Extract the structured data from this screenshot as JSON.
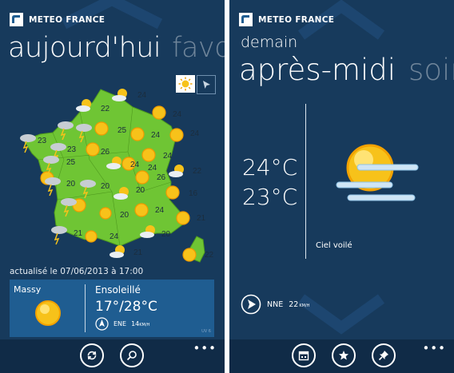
{
  "left": {
    "brand": "METEO FRANCE",
    "pivot_current": "aujourd'hui",
    "pivot_next": "favo",
    "map": {
      "temperatures": [
        "24",
        "22",
        "24",
        "25",
        "24",
        "23",
        "24",
        "24",
        "26",
        "23",
        "24",
        "25",
        "24",
        "22",
        "20",
        "26",
        "16",
        "20",
        "20",
        "24",
        "21",
        "21",
        "20",
        "24",
        "20",
        "22"
      ],
      "toolbar_icons": [
        "sun-icon",
        "cursor-icon"
      ]
    },
    "updated": "actualisé le 07/06/2013 à 17:00",
    "tile": {
      "city": "Massy",
      "condition": "Ensoleillé",
      "temps": "17°/28°C",
      "wind_dir": "ENE",
      "wind_speed": "14",
      "wind_unit": "KM/H",
      "uv": "UV 6"
    },
    "appbar": {
      "buttons": [
        "refresh-icon",
        "search-icon"
      ],
      "more": "•••"
    }
  },
  "right": {
    "brand": "METEO FRANCE",
    "day": "demain",
    "pivot_current": "après-midi",
    "pivot_next": "soir",
    "temp_max": "24°C",
    "temp_min": "23°C",
    "condition": "Ciel voilé",
    "wind_dir": "NNE",
    "wind_speed": "22",
    "wind_unit": "KM/H",
    "appbar": {
      "buttons": [
        "calendar-icon",
        "add-favorite-icon",
        "pin-icon"
      ],
      "more": "•••"
    }
  },
  "colors": {
    "background": "#173a5c",
    "tile": "#1f5d91",
    "map": "#6fc534",
    "sun": "#f7c21a"
  }
}
